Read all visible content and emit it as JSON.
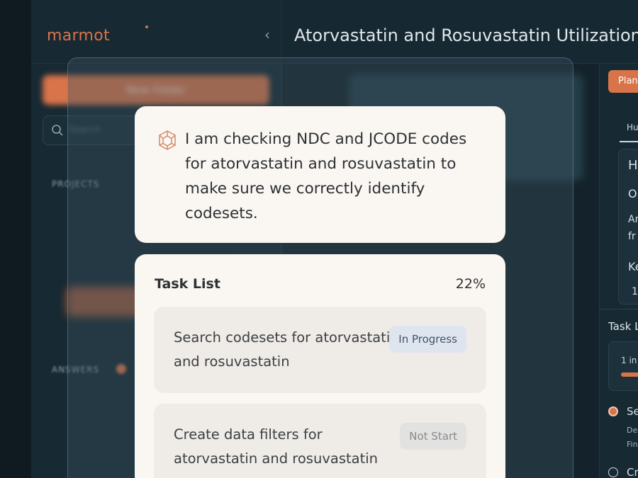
{
  "app": {
    "brand": "marmot",
    "page_title": "Atorvastatin and Rosuvastatin Utilization"
  },
  "sidebar": {
    "new_button_label": "New Folder",
    "search_placeholder": "Search",
    "projects_label": "PROJECTS",
    "answers_label": "ANSWERS"
  },
  "right_panel": {
    "plan_button": "Plan",
    "tab": "Hu",
    "card_lines": [
      "H",
      "O",
      "Ar",
      "fr",
      "Ke",
      "1"
    ],
    "task_list_label": "Task L",
    "progress_text": "1 in",
    "item1_title": "Se",
    "item1_line1": "De",
    "item1_line2": "Fin",
    "item2_title": "Cr"
  },
  "message": {
    "icon": "cube-icon",
    "text": "I am checking NDC and JCODE codes for atorvastatin and rosuvastatin to make sure we correctly identify codesets."
  },
  "task_list": {
    "title": "Task List",
    "percent": "22%",
    "items": [
      {
        "text": "Search codesets for atorvastatin and rosuvastatin",
        "status": "In Progress"
      },
      {
        "text": "Create data filters for atorvastatin and rosuvastatin",
        "status": "Not Start"
      }
    ]
  },
  "colors": {
    "accent": "#d9744a",
    "background": "#14232b",
    "card": "#faf6f2"
  }
}
